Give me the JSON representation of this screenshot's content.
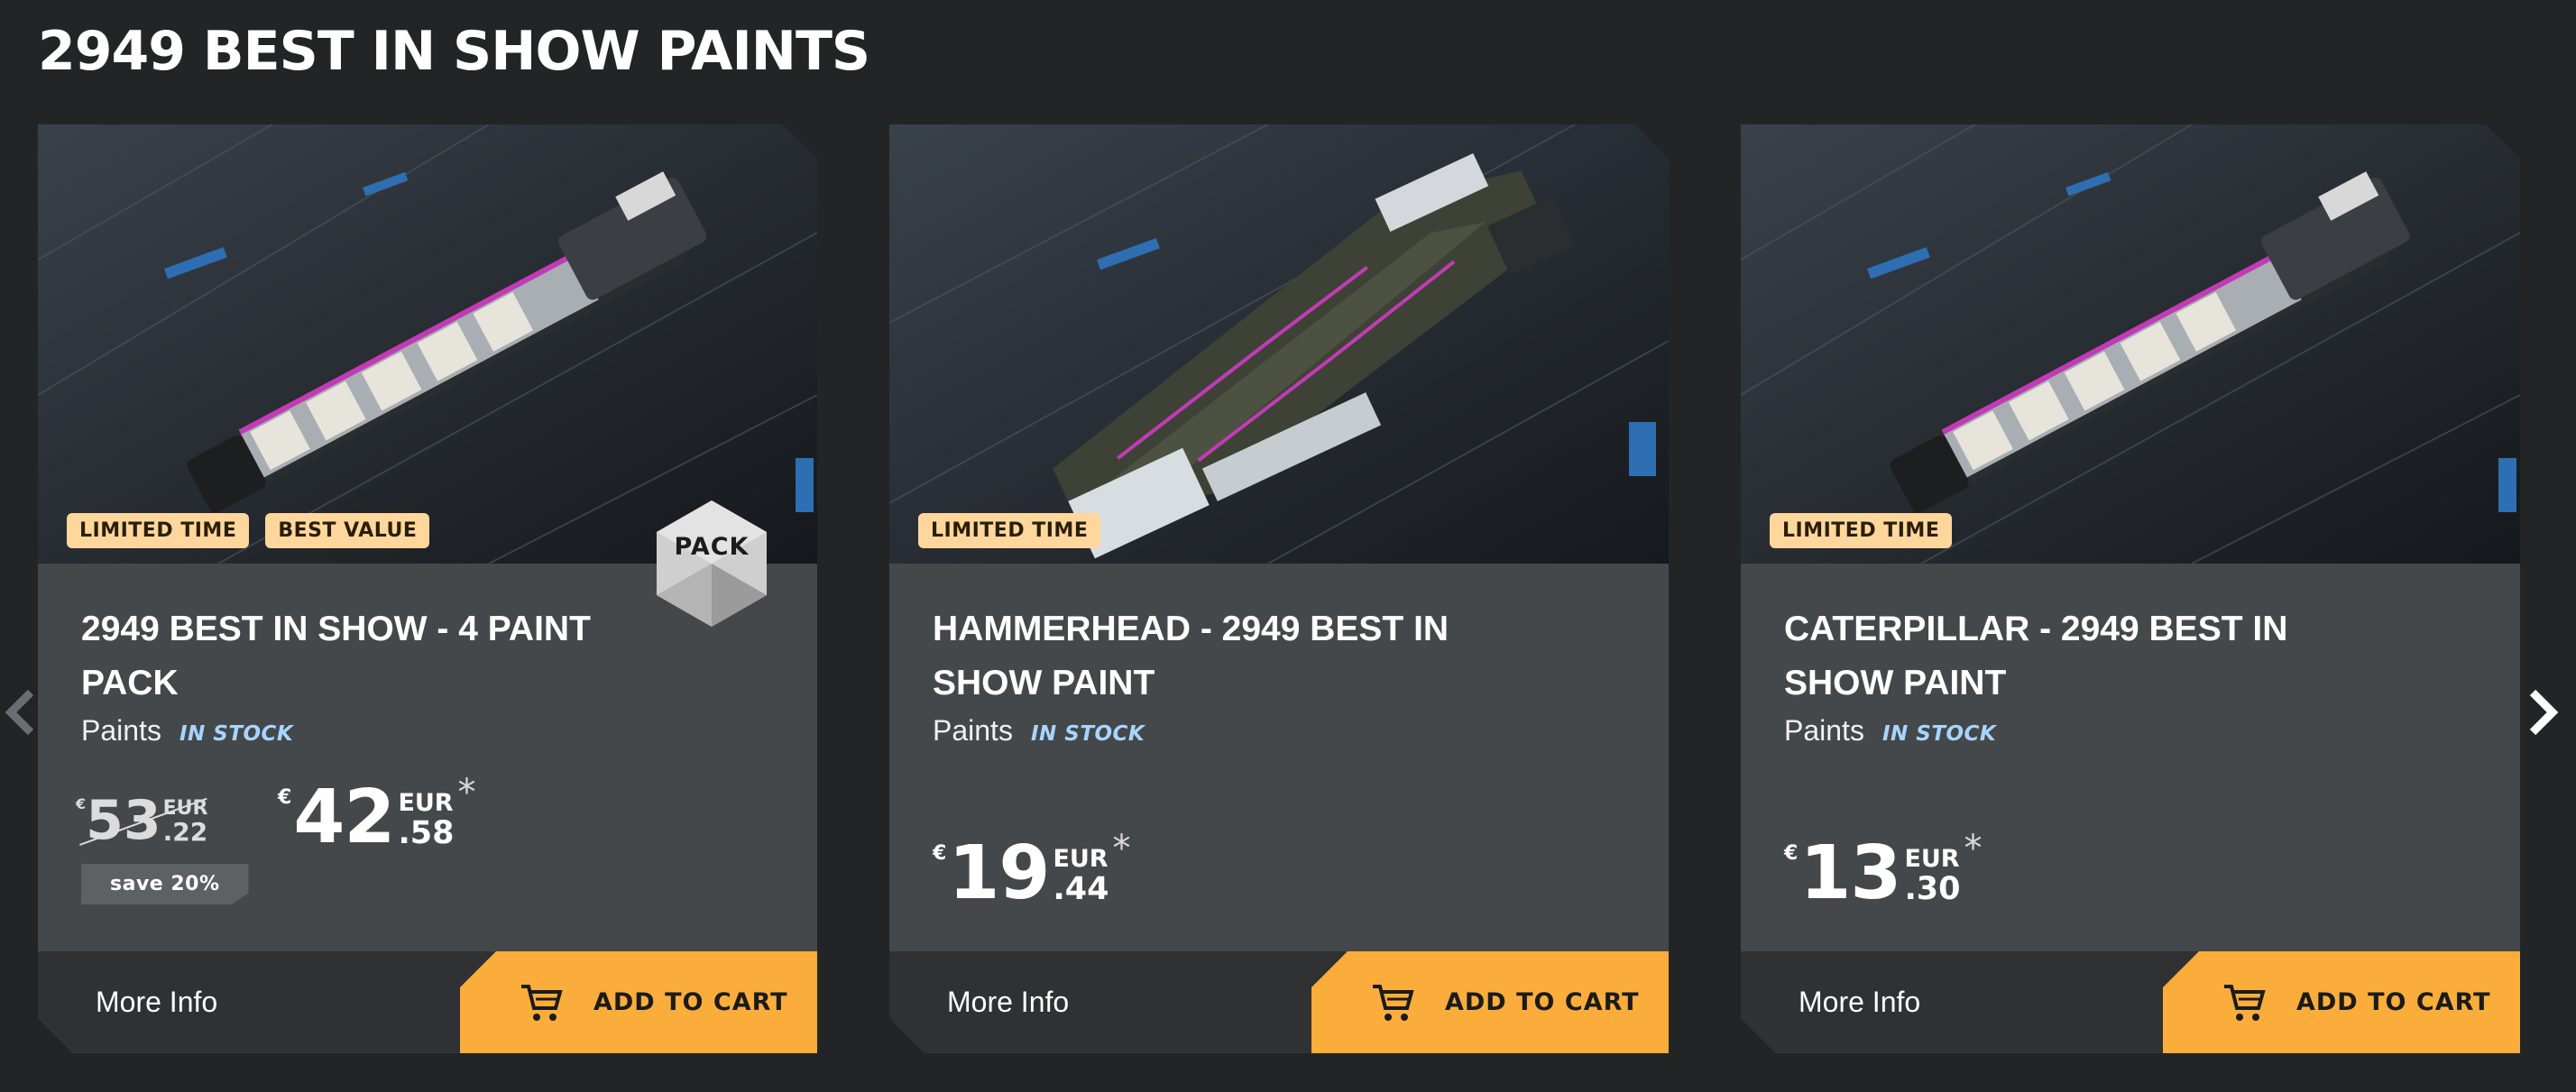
{
  "section": {
    "title": "2949 BEST IN SHOW PAINTS"
  },
  "colors": {
    "background": "#232426",
    "card": "#45484a",
    "footer": "#2f3133",
    "accent": "#fbad3b",
    "badge": "#ffd79c",
    "stock": "#a8d4ff"
  },
  "icons": {
    "prev": "chevron-left-icon",
    "next": "chevron-right-icon",
    "cart": "cart-icon"
  },
  "cards": [
    {
      "badges": [
        "LIMITED TIME",
        "BEST VALUE"
      ],
      "pack_label": "PACK",
      "title": "2949 BEST IN SHOW - 4 PAINT PACK",
      "category": "Paints",
      "stock": "IN STOCK",
      "old_price": {
        "symbol": "€",
        "whole": "53",
        "currency": "EUR",
        "cents": ".22"
      },
      "price": {
        "symbol": "€",
        "whole": "42",
        "currency": "EUR",
        "cents": ".58",
        "asterisk": "*"
      },
      "save": "save 20%",
      "more_info": "More Info",
      "add_to_cart": "ADD TO CART"
    },
    {
      "badges": [
        "LIMITED TIME"
      ],
      "title": "HAMMERHEAD - 2949 BEST IN SHOW PAINT",
      "category": "Paints",
      "stock": "IN STOCK",
      "price": {
        "symbol": "€",
        "whole": "19",
        "currency": "EUR",
        "cents": ".44",
        "asterisk": "*"
      },
      "more_info": "More Info",
      "add_to_cart": "ADD TO CART"
    },
    {
      "badges": [
        "LIMITED TIME"
      ],
      "title": "CATERPILLAR - 2949 BEST IN SHOW PAINT",
      "category": "Paints",
      "stock": "IN STOCK",
      "price": {
        "symbol": "€",
        "whole": "13",
        "currency": "EUR",
        "cents": ".30",
        "asterisk": "*"
      },
      "more_info": "More Info",
      "add_to_cart": "ADD TO CART"
    }
  ]
}
